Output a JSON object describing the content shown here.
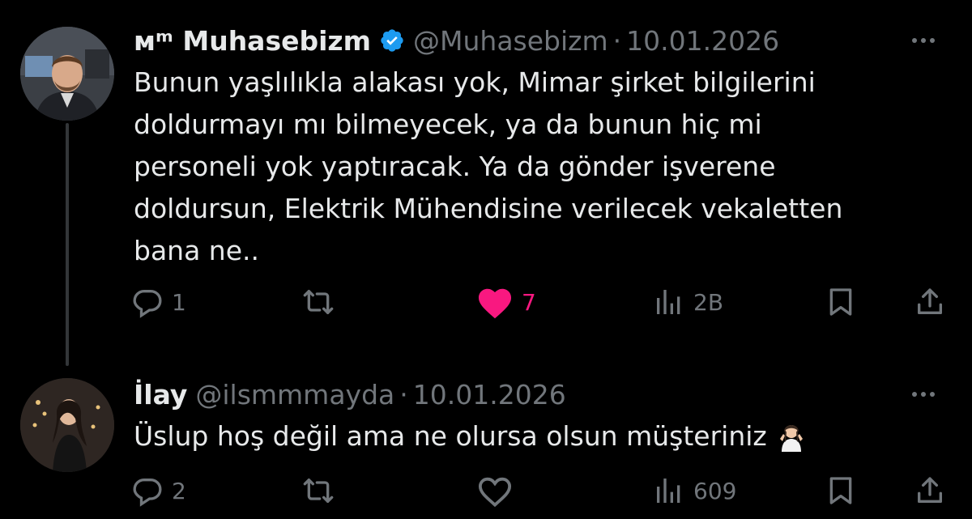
{
  "colors": {
    "background": "#000000",
    "text": "#e7e9ea",
    "muted": "#71767b",
    "verified": "#1d9bf0",
    "like_active": "#f91880",
    "thread_line": "#333639"
  },
  "tweets": [
    {
      "display_name": "ᴍᵐ Muhasebizm",
      "verified": true,
      "handle": "@Muhasebizm",
      "separator": "·",
      "date": "10.01.2026",
      "text": "Bunun yaşlılıkla alakası yok, Mimar şirket bilgilerini\ndoldurmayı mı bilmeyecek, ya da bunun hiç mi\npersoneli yok yaptıracak. Ya da gönder işverene\ndoldursun, Elektrik Mühendisine verilecek vekaletten\nbana ne..",
      "actions": {
        "reply_count": "1",
        "retweet_count": "",
        "like_count": "7",
        "liked": true,
        "views_count": "2B"
      }
    },
    {
      "display_name": "İlay",
      "verified": false,
      "handle": "@ilsmmmayda",
      "separator": "·",
      "date": "10.01.2026",
      "text": "Üslup hoş değil ama ne olursa olsun müşteriniz",
      "actions": {
        "reply_count": "2",
        "retweet_count": "",
        "like_count": "",
        "liked": false,
        "views_count": "609"
      }
    }
  ]
}
